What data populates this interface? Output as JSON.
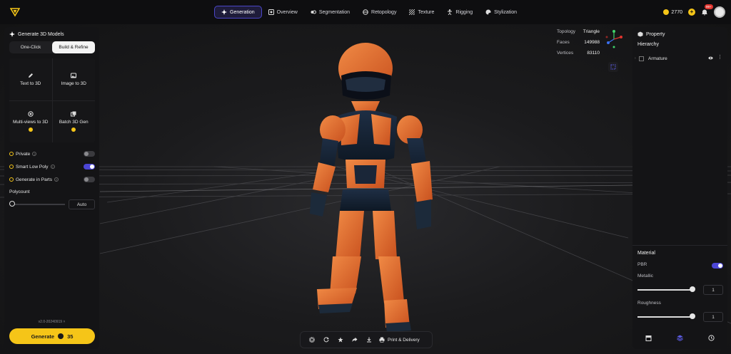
{
  "topbar": {
    "logo": "brand-v-logo",
    "nav": [
      {
        "label": "Generation",
        "icon": "sparkle-icon",
        "active": true
      },
      {
        "label": "Overview",
        "icon": "overview-icon",
        "active": false
      },
      {
        "label": "Segmentation",
        "icon": "segmentation-icon",
        "active": false
      },
      {
        "label": "Retopology",
        "icon": "retopology-icon",
        "active": false
      },
      {
        "label": "Texture",
        "icon": "texture-icon",
        "active": false
      },
      {
        "label": "Rigging",
        "icon": "rigging-icon",
        "active": false
      },
      {
        "label": "Stylization",
        "icon": "palette-icon",
        "active": false
      }
    ],
    "credits": "2770",
    "notification_count": "99+"
  },
  "left_panel": {
    "title": "Generate 3D Models",
    "segment": {
      "option_a": "One-Click",
      "option_b": "Build & Refine",
      "selected": "Build & Refine"
    },
    "modes": [
      {
        "label": "Text to 3D",
        "icon": "pen-icon",
        "pro": false
      },
      {
        "label": "Image to 3D",
        "icon": "image-icon",
        "pro": false
      },
      {
        "label": "Multi-views to 3D",
        "icon": "multiview-icon",
        "pro": true
      },
      {
        "label": "Batch 3D Gen",
        "icon": "batch-icon",
        "pro": true
      }
    ],
    "options": [
      {
        "label": "Private",
        "enabled": false
      },
      {
        "label": "Smart Low Poly",
        "enabled": true
      },
      {
        "label": "Generate in Parts",
        "enabled": false
      }
    ],
    "polycount_label": "Polycount",
    "polycount_value": "Auto",
    "version": "v2.0-20240919",
    "generate_label": "Generate",
    "generate_cost": "35"
  },
  "viewport": {
    "stats": [
      {
        "key": "Topology",
        "value": "Triangle"
      },
      {
        "key": "Faces",
        "value": "149988"
      },
      {
        "key": "Vertices",
        "value": "83110"
      }
    ]
  },
  "right_panel": {
    "title": "Property",
    "hierarchy_label": "Hierarchy",
    "armature_label": "Armature",
    "material_label": "Material",
    "pbr_label": "PBR",
    "pbr_enabled": true,
    "metallic_label": "Metallic",
    "metallic_value": "1",
    "roughness_label": "Roughness",
    "roughness_value": "1"
  },
  "bottom_toolbar": {
    "print_label": "Print & Delivery"
  },
  "colors": {
    "accent": "#4c46d6",
    "primary_yellow": "#f5c518",
    "robot_orange": "#e0692e",
    "robot_dark": "#1c2a3a"
  }
}
